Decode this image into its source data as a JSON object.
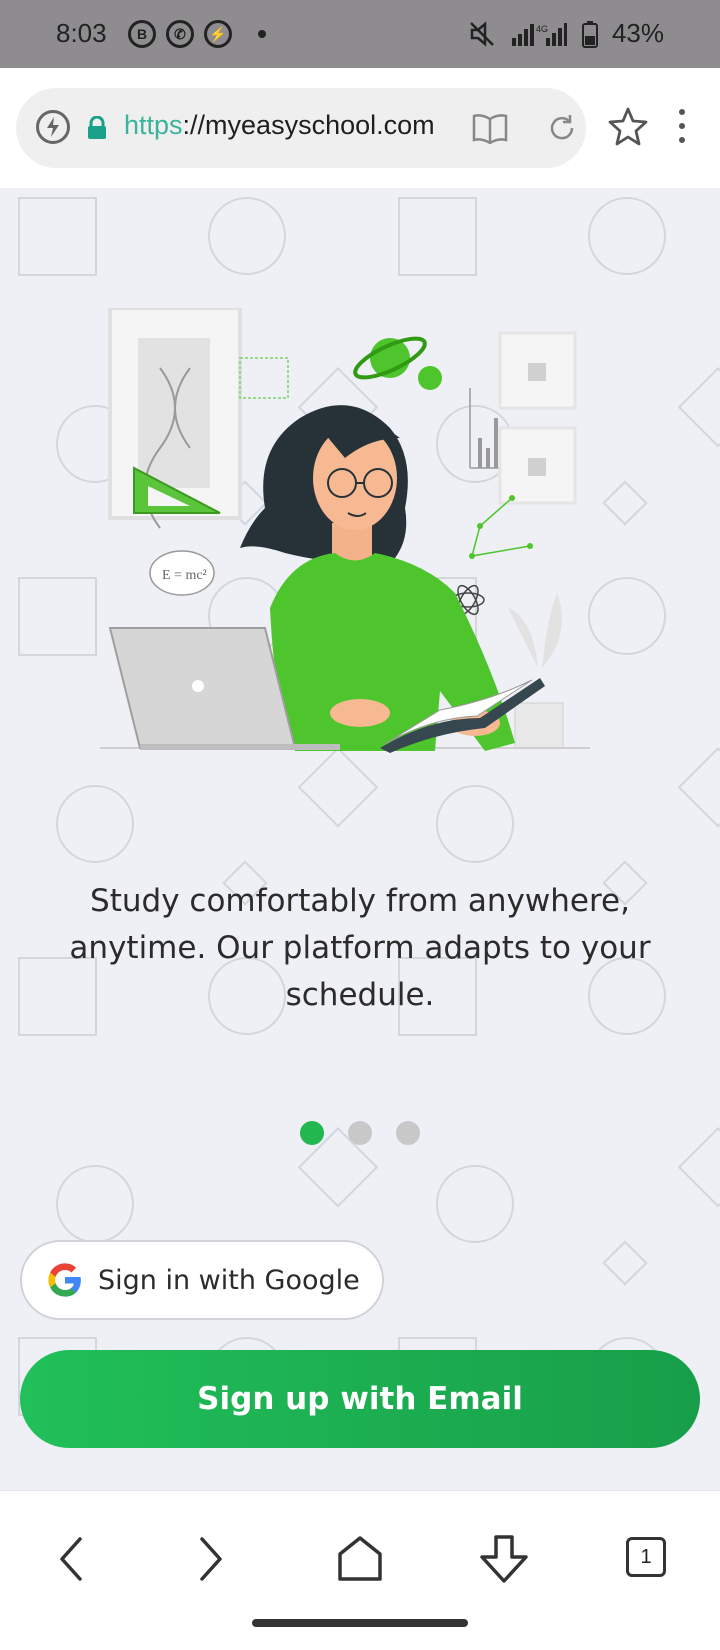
{
  "status_bar": {
    "time": "8:03",
    "left_icons": [
      "b-icon",
      "whatsapp-icon",
      "messenger-icon"
    ],
    "battery": "43%",
    "network": "4G",
    "right_icons": [
      "mute-icon",
      "signal-icon",
      "battery-icon"
    ]
  },
  "browser": {
    "url_scheme": "https",
    "url_rest": "://myeasyschool.com",
    "icons": [
      "bolt-icon",
      "lock-icon",
      "reader-mode-icon",
      "reload-icon",
      "star-icon",
      "more-icon"
    ]
  },
  "main": {
    "tagline": "Study comfortably from anywhere, anytime. Our platform adapts to your schedule.",
    "carousel": {
      "total": 3,
      "active": 1
    },
    "google_button": "Sign in with Google",
    "email_button": "Sign up with Email",
    "accent_color": "#22b84f"
  },
  "bottom_nav": {
    "items": [
      "back-icon",
      "forward-icon",
      "home-icon",
      "download-icon",
      "tabs-icon"
    ],
    "tab_count": "1"
  }
}
